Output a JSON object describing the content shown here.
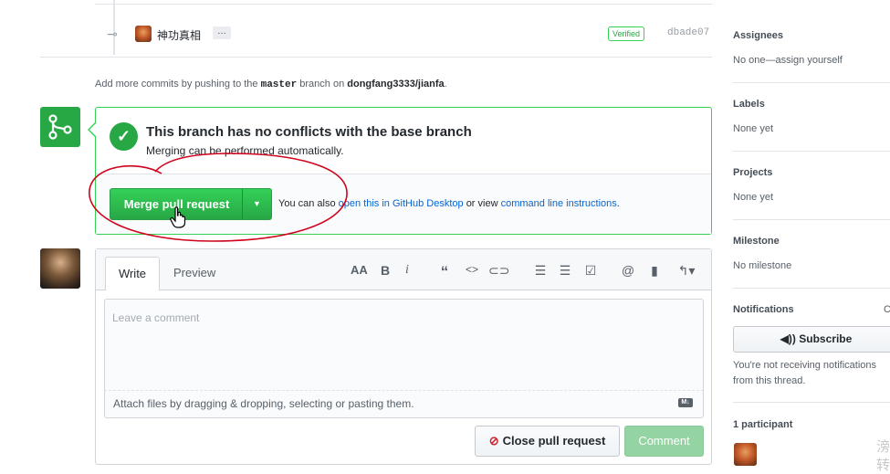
{
  "commit": {
    "message": "神功真相",
    "ellipsis": "…",
    "verified": "Verified",
    "sha": "dbade07"
  },
  "push_note": {
    "prefix": "Add more commits by pushing to the",
    "branch": "master",
    "mid": "branch on",
    "repo": "dongfang3333/jianfa",
    "suffix": "."
  },
  "merge": {
    "title": "This branch has no conflicts with the base branch",
    "subtitle": "Merging can be performed automatically.",
    "button_label": "Merge pull request",
    "help_prefix": "You can also",
    "desktop_link": "open this in GitHub Desktop",
    "help_mid": "or view",
    "cli_link": "command line instructions",
    "help_suffix": ".",
    "annotation_color": "#d0021b"
  },
  "comment": {
    "tab_write": "Write",
    "tab_preview": "Preview",
    "toolbar": [
      "AA",
      "B",
      "i",
      "“",
      "<>",
      "link",
      "ul",
      "ol",
      "task",
      "@",
      "bookmark",
      "reply"
    ],
    "placeholder": "Leave a comment",
    "attach": "Attach files by dragging & dropping, selecting or pasting them.",
    "close_button": "Close pull request",
    "comment_button": "Comment",
    "md_badge": "M↓"
  },
  "sidebar": {
    "assignees_label": "Assignees",
    "assignees_value": "No one—assign yourself",
    "labels_label": "Labels",
    "labels_value": "None yet",
    "projects_label": "Projects",
    "projects_value": "None yet",
    "milestone_label": "Milestone",
    "milestone_value": "No milestone",
    "notifications_label": "Notifications",
    "notifications_cut": "C",
    "subscribe_label": "Subscribe",
    "notif_text": "You're not receiving notifications from this thread.",
    "participants_label": "1 participant"
  },
  "watermark": [
    "滂",
    "转"
  ],
  "colors": {
    "green": "#28a745",
    "link": "#0366d6",
    "annotation_red": "#d0021b"
  }
}
